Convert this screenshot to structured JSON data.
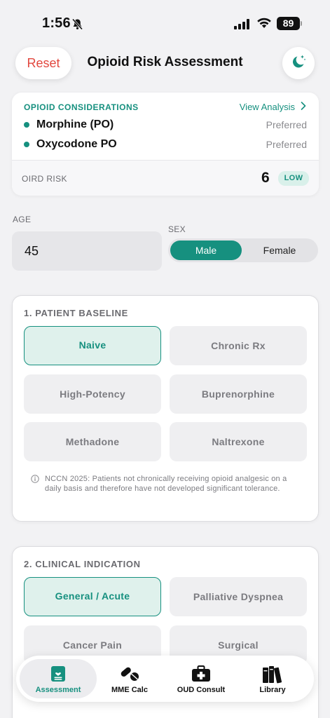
{
  "status_bar": {
    "time": "1:56",
    "battery": "89"
  },
  "header": {
    "reset_label": "Reset",
    "title": "Opioid Risk Assessment",
    "theme_icon": "moon-sparkle-icon"
  },
  "considerations": {
    "heading": "OPIOID CONSIDERATIONS",
    "view_analysis": "View Analysis",
    "drugs": [
      {
        "name": "Morphine (PO)",
        "status": "Preferred"
      },
      {
        "name": "Oxycodone PO",
        "status": "Preferred"
      }
    ],
    "oird_label": "OIRD RISK",
    "oird_score": "6",
    "oird_level": "LOW"
  },
  "demographics": {
    "age_label": "AGE",
    "age_value": "45",
    "sex_label": "SEX",
    "sex_options": [
      "Male",
      "Female"
    ],
    "sex_selected": "Male"
  },
  "section1": {
    "title": "1. PATIENT BASELINE",
    "options": [
      "Naive",
      "Chronic Rx",
      "High-Potency",
      "Buprenorphine",
      "Methadone",
      "Naltrexone"
    ],
    "selected": "Naive",
    "note": "NCCN 2025: Patients not chronically receiving opioid analgesic on a daily basis and therefore have not developed significant tolerance."
  },
  "section2": {
    "title": "2. CLINICAL INDICATION",
    "options": [
      "General / Acute",
      "Palliative Dyspnea",
      "Cancer Pain",
      "Surgical"
    ],
    "selected": "General / Acute"
  },
  "tab_bar": {
    "tabs": [
      {
        "label": "Assessment",
        "icon": "clipboard-heart-icon"
      },
      {
        "label": "MME Calc",
        "icon": "pills-icon"
      },
      {
        "label": "OUD Consult",
        "icon": "medical-bag-icon"
      },
      {
        "label": "Library",
        "icon": "books-icon"
      }
    ],
    "active": "Assessment"
  },
  "colors": {
    "accent": "#16907f",
    "reset_red": "#e2483f",
    "background": "#f2f2f4"
  }
}
